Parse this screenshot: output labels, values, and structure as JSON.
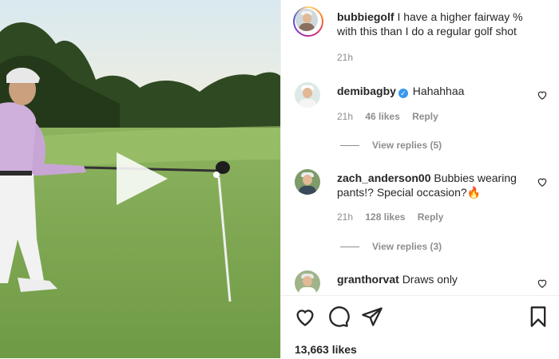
{
  "post": {
    "author": "bubbiegolf",
    "caption": "I have a higher fairway % with this than I do a regular golf shot",
    "time": "21h"
  },
  "comments": [
    {
      "user": "demibagby",
      "verified": true,
      "text": "Hahahhaa",
      "time": "21h",
      "likes": "46 likes",
      "reply": "Reply",
      "view_replies": "View replies (5)"
    },
    {
      "user": "zach_anderson00",
      "verified": false,
      "text": "Bubbies wearing pants!? Special occasion?",
      "emoji": "🔥",
      "time": "21h",
      "likes": "128 likes",
      "reply": "Reply",
      "view_replies": "View replies (3)"
    },
    {
      "user": "granthorvat",
      "verified": false,
      "text": "Draws only"
    }
  ],
  "footer": {
    "likes_total": "13,663 likes"
  },
  "icons": {
    "like": "heart-icon",
    "comment": "comment-icon",
    "share": "share-icon",
    "save": "bookmark-icon",
    "play": "play-icon"
  },
  "colors": {
    "text": "#262626",
    "secondary": "#8e8e8e",
    "verified": "#3897f0",
    "fire": "#f56a00"
  }
}
